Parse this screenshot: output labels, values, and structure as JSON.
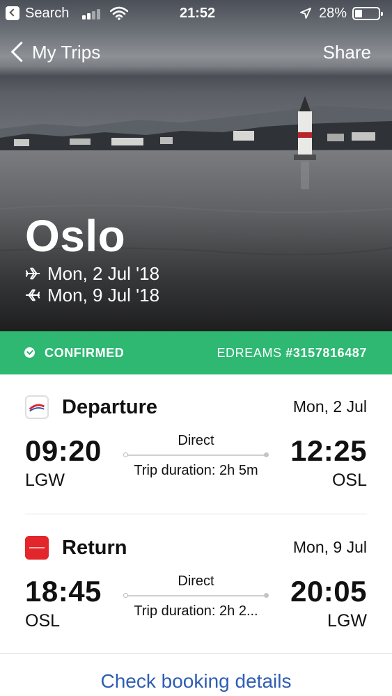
{
  "status_bar": {
    "back_app": "Search",
    "time": "21:52",
    "battery_percent": "28%",
    "battery_level": 0.28
  },
  "nav": {
    "back_label": "My Trips",
    "share_label": "Share"
  },
  "trip": {
    "city": "Oslo",
    "outbound_date": "Mon, 2 Jul '18",
    "return_date": "Mon, 9 Jul '18"
  },
  "booking": {
    "status": "CONFIRMED",
    "provider": "EDREAMS",
    "reference": "#3157816487",
    "status_color": "#2eb872"
  },
  "flights": [
    {
      "kind": "Departure",
      "date": "Mon, 2 Jul",
      "dep_time": "09:20",
      "dep_airport": "LGW",
      "arr_time": "12:25",
      "arr_airport": "OSL",
      "route_type": "Direct",
      "duration": "Trip duration: 2h 5m",
      "airline_logo": "airline-logo-icon"
    },
    {
      "kind": "Return",
      "date": "Mon, 9 Jul",
      "dep_time": "18:45",
      "dep_airport": "OSL",
      "arr_time": "20:05",
      "arr_airport": "LGW",
      "route_type": "Direct",
      "duration": "Trip duration: 2h 2...",
      "airline_logo": "norwegian-logo-icon"
    }
  ],
  "actions": {
    "check_booking": "Check booking details",
    "link_color": "#2f5db4"
  }
}
